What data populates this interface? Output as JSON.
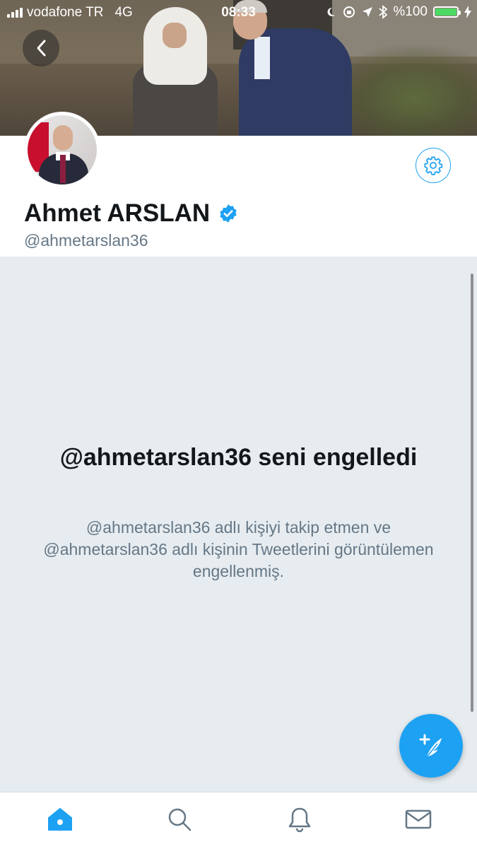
{
  "status_bar": {
    "carrier": "vodafone TR",
    "network": "4G",
    "time": "08:33",
    "battery_text": "%100",
    "battery_level": 1.0
  },
  "profile": {
    "name": "Ahmet ARSLAN",
    "handle": "@ahmetarslan36",
    "verified": true
  },
  "blocked": {
    "title": "@ahmetarslan36 seni engelledi",
    "description": "@ahmetarslan36 adlı kişiyi takip etmen ve @ahmetarslan36 adlı kişinin Tweetlerini görüntülemen engellenmiş."
  },
  "tabs": [
    {
      "icon": "home-icon",
      "active": true
    },
    {
      "icon": "search-icon",
      "active": false
    },
    {
      "icon": "bell-icon",
      "active": false
    },
    {
      "icon": "mail-icon",
      "active": false
    }
  ],
  "colors": {
    "accent": "#1da1f2",
    "background": "#e6ecf0",
    "text_primary": "#14171a",
    "text_secondary": "#657786"
  }
}
